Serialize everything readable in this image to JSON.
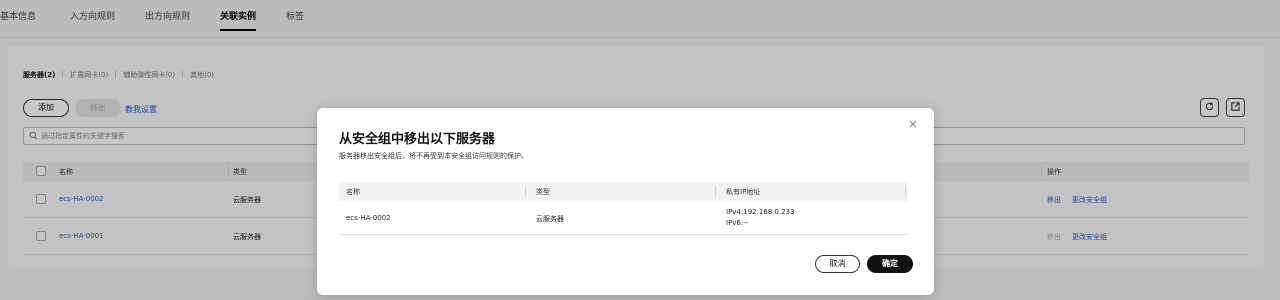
{
  "top_tabs": [
    {
      "label": "基本信息"
    },
    {
      "label": "入方向规则"
    },
    {
      "label": "出方向规则"
    },
    {
      "label": "关联实例"
    },
    {
      "label": "标签"
    }
  ],
  "sub_tabs": [
    {
      "label": "服务器(2)"
    },
    {
      "label": "扩展网卡(0)"
    },
    {
      "label": "辅助弹性网卡(0)"
    },
    {
      "label": "其他(0)"
    }
  ],
  "toolbar": {
    "add_label": "添加",
    "remove_label": "移出",
    "help_link": "教我设置"
  },
  "search": {
    "placeholder": "通过指定属性的关键字搜索"
  },
  "table": {
    "headers": {
      "name": "名称",
      "type": "类型",
      "actions": "操作"
    },
    "rows": [
      {
        "name": "ecs-HA-0002",
        "type": "云服务器",
        "remove": "移出",
        "change": "更改安全组"
      },
      {
        "name": "ecs-HA-0001",
        "type": "云服务器",
        "remove": "移出",
        "change": "更改安全组"
      }
    ]
  },
  "dialog": {
    "close": "×",
    "title": "从安全组中移出以下服务器",
    "description": "服务器移出安全组后，将不再受到本安全组访问规则的保护。",
    "headers": {
      "name": "名称",
      "type": "类型",
      "ip": "私有IP地址"
    },
    "rows": [
      {
        "name": "ecs-HA-0002",
        "type": "云服务器",
        "ipv4": "IPv4:192.168.0.233",
        "ipv6": "IPv6:--"
      }
    ],
    "cancel_label": "取消",
    "ok_label": "确定"
  },
  "colors": {
    "link": "#1d5cd8",
    "primary_button": "#111111"
  },
  "icons": [
    "refresh-icon",
    "export-icon",
    "search-icon",
    "close-icon"
  ]
}
